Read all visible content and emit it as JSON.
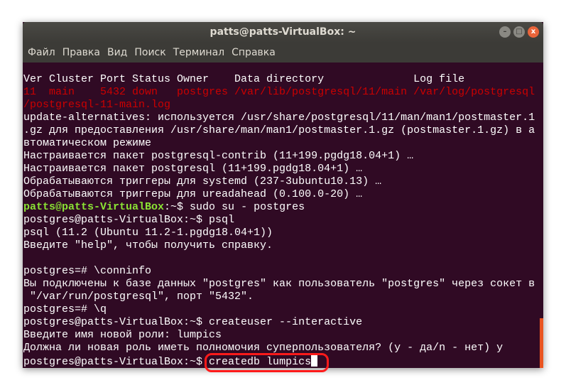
{
  "window": {
    "title": "patts@patts-VirtualBox: ~"
  },
  "menu": [
    "Файл",
    "Правка",
    "Вид",
    "Поиск",
    "Терминал",
    "Справка"
  ],
  "colors": {
    "background": "#300a24",
    "error": "#cc0000",
    "prompt": "#8ae234",
    "accent": "#e95420",
    "highlight": "#ff1a1a"
  },
  "terminal": {
    "lines": [
      [
        {
          "t": "Ver Cluster Port Status Owner    Data directory              Log file",
          "c": ""
        }
      ],
      [
        {
          "t": "11  main    5432 down   postgres /var/lib/postgresql/11/main /var/log/postgresql",
          "c": "red"
        }
      ],
      [
        {
          "t": "/postgresql-11-main.log",
          "c": "red"
        }
      ],
      [
        {
          "t": "update-alternatives: используется /usr/share/postgresql/11/man/man1/postmaster.1",
          "c": ""
        }
      ],
      [
        {
          "t": ".gz для предоставления /usr/share/man/man1/postmaster.1.gz (postmaster.1.gz) в а",
          "c": ""
        }
      ],
      [
        {
          "t": "втоматическом режиме",
          "c": ""
        }
      ],
      [
        {
          "t": "Настраивается пакет postgresql-contrib (11+199.pgdg18.04+1) …",
          "c": ""
        }
      ],
      [
        {
          "t": "Настраивается пакет postgresql (11+199.pgdg18.04+1) …",
          "c": ""
        }
      ],
      [
        {
          "t": "Обрабатываются триггеры для systemd (237-3ubuntu10.13) …",
          "c": ""
        }
      ],
      [
        {
          "t": "Обрабатываются триггеры для ureadahead (0.100.0-20) …",
          "c": ""
        }
      ],
      [
        {
          "t": "patts@patts-VirtualBox",
          "c": "green"
        },
        {
          "t": ":~$ sudo su - postgres",
          "c": ""
        }
      ],
      [
        {
          "t": "postgres@patts-VirtualBox:~$ psql",
          "c": ""
        }
      ],
      [
        {
          "t": "psql (11.2 (Ubuntu 11.2-1.pgdg18.04+1))",
          "c": ""
        }
      ],
      [
        {
          "t": "Введите \"help\", чтобы получить справку.",
          "c": ""
        }
      ],
      [
        {
          "t": "",
          "c": ""
        }
      ],
      [
        {
          "t": "postgres=# \\conninfo",
          "c": ""
        }
      ],
      [
        {
          "t": "Вы подключены к базе данных \"postgres\" как пользователь \"postgres\" через сокет в",
          "c": ""
        }
      ],
      [
        {
          "t": " \"/var/run/postgresql\", порт \"5432\".",
          "c": ""
        }
      ],
      [
        {
          "t": "postgres=# \\q",
          "c": ""
        }
      ],
      [
        {
          "t": "postgres@patts-VirtualBox:~$ createuser --interactive",
          "c": ""
        }
      ],
      [
        {
          "t": "Введите имя новой роли: lumpics",
          "c": ""
        }
      ],
      [
        {
          "t": "Должна ли новая роль иметь полномочия суперпользователя? (y - да/n - нет) y",
          "c": ""
        }
      ],
      [
        {
          "t": "postgres@patts-VirtualBox:~$ ",
          "c": ""
        },
        {
          "t": "createdb lumpics",
          "c": ""
        }
      ]
    ]
  }
}
